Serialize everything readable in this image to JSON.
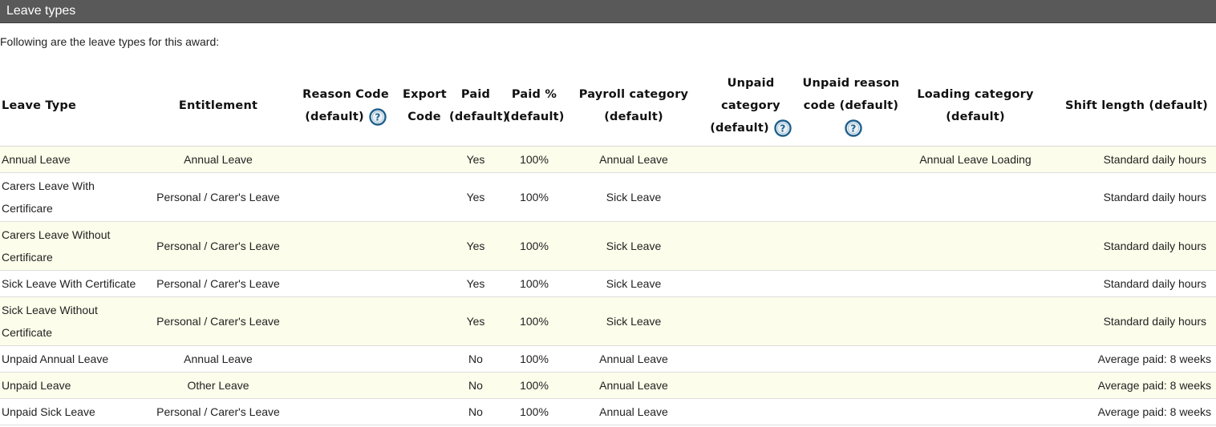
{
  "section_title": "Leave types",
  "intro_text": "Following are the leave types for this award:",
  "columns": [
    "Leave Type",
    "Entitlement",
    "Reason Code (default)",
    "Export Code",
    "Paid (default)",
    "Paid % (default)",
    "Payroll category (default)",
    "Unpaid category (default)",
    "Unpaid reason code (default)",
    "Loading category (default)",
    "Shift length (default)"
  ],
  "column_help": [
    "help-icon",
    "help-icon",
    "help-icon"
  ],
  "rows": [
    {
      "leave_type": "Annual Leave",
      "entitlement": "Annual Leave",
      "reason_code": "",
      "export_code": "",
      "paid": "Yes",
      "paid_pct": "100%",
      "payroll_category": "Annual Leave",
      "unpaid_category": "",
      "unpaid_reason_code": "",
      "loading_category": "Annual Leave Loading",
      "shift_length": "Standard daily hours"
    },
    {
      "leave_type": "Carers Leave With Certificare",
      "entitlement": "Personal / Carer's Leave",
      "reason_code": "",
      "export_code": "",
      "paid": "Yes",
      "paid_pct": "100%",
      "payroll_category": "Sick Leave",
      "unpaid_category": "",
      "unpaid_reason_code": "",
      "loading_category": "",
      "shift_length": "Standard daily hours"
    },
    {
      "leave_type": "Carers Leave Without Certificare",
      "entitlement": "Personal / Carer's Leave",
      "reason_code": "",
      "export_code": "",
      "paid": "Yes",
      "paid_pct": "100%",
      "payroll_category": "Sick Leave",
      "unpaid_category": "",
      "unpaid_reason_code": "",
      "loading_category": "",
      "shift_length": "Standard daily hours"
    },
    {
      "leave_type": "Sick Leave With Certificate",
      "entitlement": "Personal / Carer's Leave",
      "reason_code": "",
      "export_code": "",
      "paid": "Yes",
      "paid_pct": "100%",
      "payroll_category": "Sick Leave",
      "unpaid_category": "",
      "unpaid_reason_code": "",
      "loading_category": "",
      "shift_length": "Standard daily hours"
    },
    {
      "leave_type": "Sick Leave Without Certificate",
      "entitlement": "Personal / Carer's Leave",
      "reason_code": "",
      "export_code": "",
      "paid": "Yes",
      "paid_pct": "100%",
      "payroll_category": "Sick Leave",
      "unpaid_category": "",
      "unpaid_reason_code": "",
      "loading_category": "",
      "shift_length": "Standard daily hours"
    },
    {
      "leave_type": "Unpaid Annual Leave",
      "entitlement": "Annual Leave",
      "reason_code": "",
      "export_code": "",
      "paid": "No",
      "paid_pct": "100%",
      "payroll_category": "Annual Leave",
      "unpaid_category": "",
      "unpaid_reason_code": "",
      "loading_category": "",
      "shift_length": "Average paid: 8 weeks"
    },
    {
      "leave_type": "Unpaid Leave",
      "entitlement": "Other Leave",
      "reason_code": "",
      "export_code": "",
      "paid": "No",
      "paid_pct": "100%",
      "payroll_category": "Annual Leave",
      "unpaid_category": "",
      "unpaid_reason_code": "",
      "loading_category": "",
      "shift_length": "Average paid: 8 weeks"
    },
    {
      "leave_type": "Unpaid Sick Leave",
      "entitlement": "Personal / Carer's Leave",
      "reason_code": "",
      "export_code": "",
      "paid": "No",
      "paid_pct": "100%",
      "payroll_category": "Annual Leave",
      "unpaid_category": "",
      "unpaid_reason_code": "",
      "loading_category": "",
      "shift_length": "Average paid: 8 weeks"
    }
  ],
  "colors": {
    "title_bar": "#595959",
    "row_alt": "#fdfdeb",
    "help_icon": "#1f5f8b"
  }
}
